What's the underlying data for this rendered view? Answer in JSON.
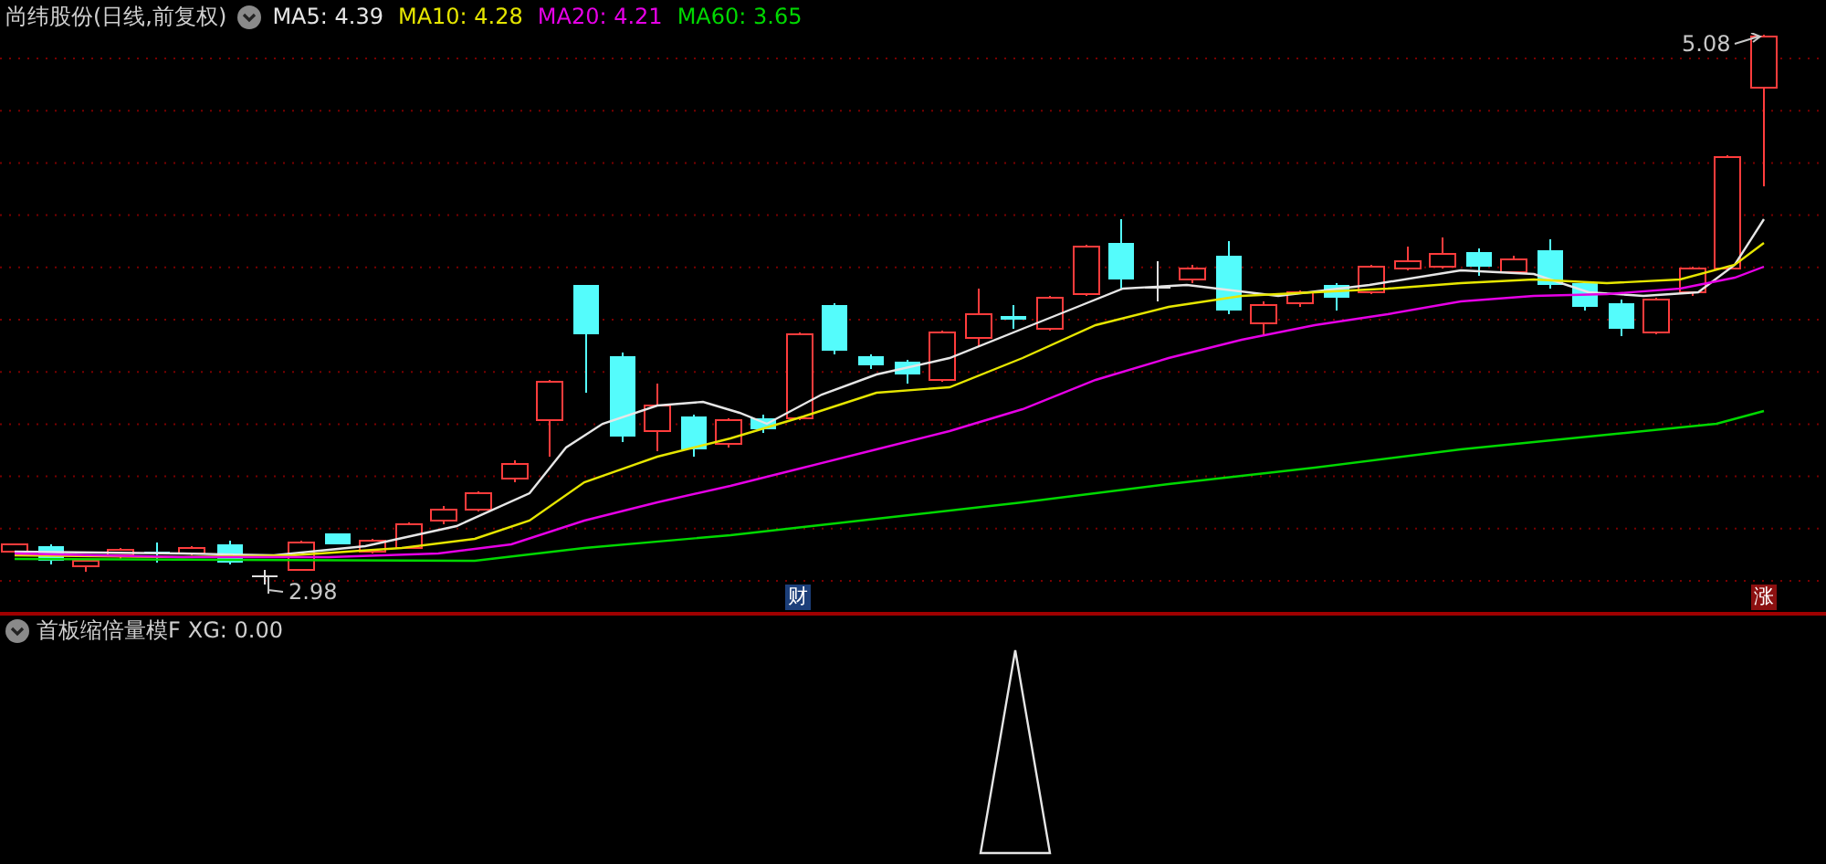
{
  "header": {
    "title": "尚纬股份(日线,前复权)",
    "ma": [
      {
        "label": "MA5: 4.39",
        "color": "#e6e6e6"
      },
      {
        "label": "MA10: 4.28",
        "color": "#e6e600"
      },
      {
        "label": "MA20: 4.21",
        "color": "#e600e6"
      },
      {
        "label": "MA60: 3.65",
        "color": "#00d800"
      }
    ]
  },
  "price_labels": [
    {
      "kind": "high",
      "text": "5.08"
    },
    {
      "kind": "low",
      "text": "2.98"
    }
  ],
  "markers": [
    {
      "kind": "finance",
      "text": "财"
    },
    {
      "kind": "limit_up",
      "text": "涨"
    }
  ],
  "indicator": {
    "name": "首板缩倍量模F",
    "reading": "XG: 0.00"
  }
}
